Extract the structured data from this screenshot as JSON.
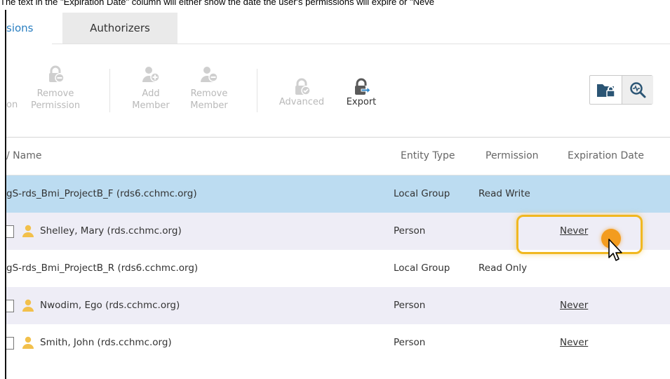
{
  "caption": "The text in the \"Expiration Date\" column will either show the date the user's permissions will expire or \"Neve",
  "tabs": {
    "active": "sions",
    "inactive": "Authorizers"
  },
  "toolbar": {
    "add_permission_partial": "on",
    "remove_permission": {
      "line1": "Remove",
      "line2": "Permission"
    },
    "add_member": {
      "line1": "Add",
      "line2": "Member"
    },
    "remove_member": {
      "line1": "Remove",
      "line2": "Member"
    },
    "advanced": "Advanced",
    "export": "Export"
  },
  "table": {
    "headers": {
      "name": "/ Name",
      "entity_type": "Entity Type",
      "permission": "Permission",
      "expiration_date": "Expiration Date"
    },
    "rows": [
      {
        "name": "gS-rds_Bmi_ProjectB_F (rds6.cchmc.org)",
        "entity_type": "Local Group",
        "permission": "Read Write",
        "expiration": ""
      },
      {
        "name": "Shelley, Mary (rds.cchmc.org)",
        "entity_type": "Person",
        "permission": "",
        "expiration": "Never"
      },
      {
        "name": "gS-rds_Bmi_ProjectB_R (rds6.cchmc.org)",
        "entity_type": "Local Group",
        "permission": "Read Only",
        "expiration": ""
      },
      {
        "name": "Nwodim, Ego (rds.cchmc.org)",
        "entity_type": "Person",
        "permission": "",
        "expiration": "Never"
      },
      {
        "name": "Smith, John (rds.cchmc.org)",
        "entity_type": "Person",
        "permission": "",
        "expiration": "Never"
      }
    ]
  },
  "colors": {
    "active_tab_text": "#2a7fc1",
    "selected_row": "#bcdcf1",
    "alt_row": "#eeedf6",
    "highlight": "#f1b820",
    "person_icon": "#f2c04b"
  }
}
